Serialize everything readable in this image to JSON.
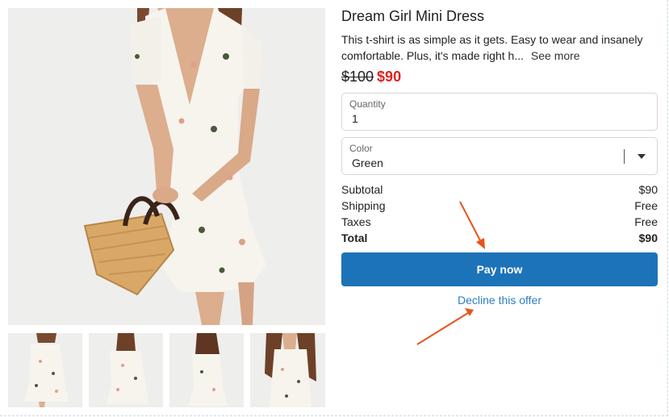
{
  "product": {
    "title": "Dream Girl Mini Dress",
    "description": "This t-shirt is as simple as it gets. Easy to wear and insanely comfortable. Plus, it's made right h...",
    "see_more_label": "See more",
    "original_price": "$100",
    "sale_price": "$90"
  },
  "form": {
    "quantity_label": "Quantity",
    "quantity_value": "1",
    "color_label": "Color",
    "color_value": "Green"
  },
  "summary": {
    "subtotal_label": "Subtotal",
    "subtotal_value": "$90",
    "shipping_label": "Shipping",
    "shipping_value": "Free",
    "taxes_label": "Taxes",
    "taxes_value": "Free",
    "total_label": "Total",
    "total_value": "$90"
  },
  "actions": {
    "pay_label": "Pay now",
    "decline_label": "Decline this offer"
  },
  "colors": {
    "pay_button": "#1d73b8",
    "sale_price": "#e22120",
    "decline_link": "#2e7ec4",
    "annotation_arrow": "#e8531c"
  }
}
